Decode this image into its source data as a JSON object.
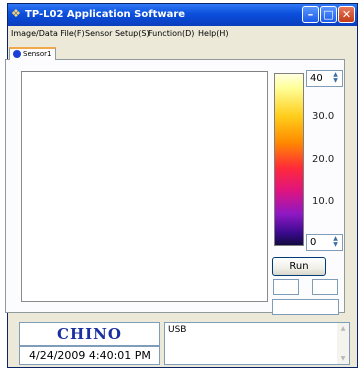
{
  "window": {
    "title": "TP-L02 Application Software"
  },
  "menu": {
    "items": [
      "Image/Data File(F)",
      "Sensor Setup(S)",
      "Function(D)",
      "Help(H)"
    ]
  },
  "tabs": [
    {
      "label": "Sensor1"
    }
  ],
  "scale": {
    "max_value": "40",
    "min_value": "0",
    "labels": [
      "30.0",
      "20.0",
      "10.0"
    ]
  },
  "controls": {
    "run_label": "Run"
  },
  "footer": {
    "logo": "CHINO",
    "timestamp": "4/24/2009 4:40:01 PM",
    "log_text": "USB"
  },
  "icons": {
    "app": "app-icon",
    "minimize": "minimize-icon",
    "maximize": "maximize-icon",
    "close": "close-icon"
  },
  "colors": {
    "titlebar": "#0b4fdc",
    "tab_accent": "#f1a84a",
    "logo": "#1a2fa0",
    "sensor_dot": "#1b3fd7"
  }
}
